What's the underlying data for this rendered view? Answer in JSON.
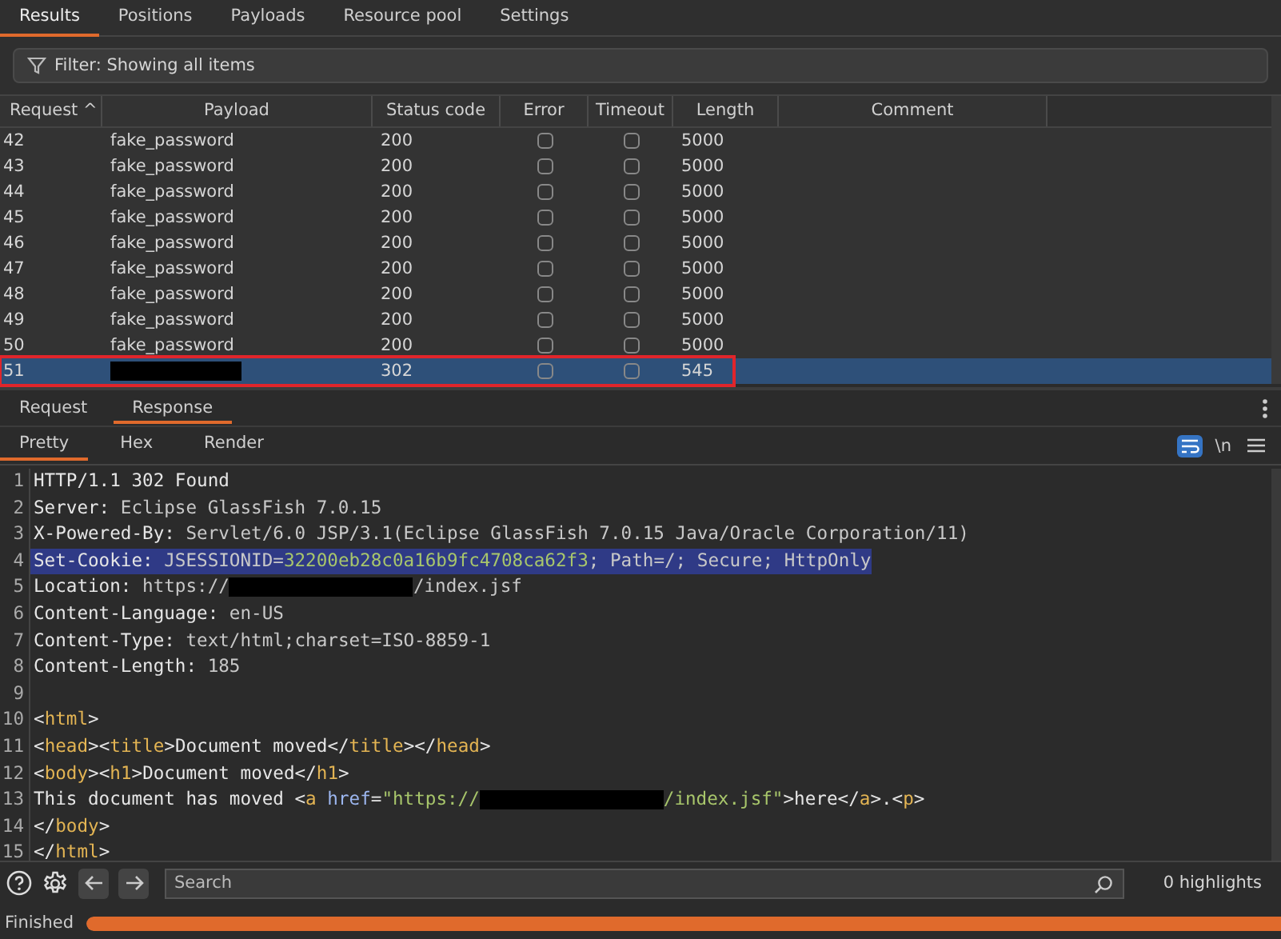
{
  "tabs": [
    {
      "label": "Results",
      "selected": true
    },
    {
      "label": "Positions",
      "selected": false
    },
    {
      "label": "Payloads",
      "selected": false
    },
    {
      "label": "Resource pool",
      "selected": false
    },
    {
      "label": "Settings",
      "selected": false
    }
  ],
  "filter": {
    "label": "Filter: Showing all items"
  },
  "table": {
    "columns": [
      {
        "label": "Request ^",
        "kind": "num"
      },
      {
        "label": "Payload",
        "kind": "text"
      },
      {
        "label": "Status code",
        "kind": "text"
      },
      {
        "label": "Error",
        "kind": "check"
      },
      {
        "label": "Timeout",
        "kind": "check"
      },
      {
        "label": "Length",
        "kind": "text"
      },
      {
        "label": "Comment",
        "kind": "text"
      }
    ],
    "rows": [
      {
        "request": "42",
        "payload": "fake_password",
        "status": "200",
        "error": false,
        "timeout": false,
        "length": "5000",
        "selected": false,
        "annotated": false
      },
      {
        "request": "43",
        "payload": "fake_password",
        "status": "200",
        "error": false,
        "timeout": false,
        "length": "5000",
        "selected": false,
        "annotated": false
      },
      {
        "request": "44",
        "payload": "fake_password",
        "status": "200",
        "error": false,
        "timeout": false,
        "length": "5000",
        "selected": false,
        "annotated": false
      },
      {
        "request": "45",
        "payload": "fake_password",
        "status": "200",
        "error": false,
        "timeout": false,
        "length": "5000",
        "selected": false,
        "annotated": false
      },
      {
        "request": "46",
        "payload": "fake_password",
        "status": "200",
        "error": false,
        "timeout": false,
        "length": "5000",
        "selected": false,
        "annotated": false
      },
      {
        "request": "47",
        "payload": "fake_password",
        "status": "200",
        "error": false,
        "timeout": false,
        "length": "5000",
        "selected": false,
        "annotated": false
      },
      {
        "request": "48",
        "payload": "fake_password",
        "status": "200",
        "error": false,
        "timeout": false,
        "length": "5000",
        "selected": false,
        "annotated": false
      },
      {
        "request": "49",
        "payload": "fake_password",
        "status": "200",
        "error": false,
        "timeout": false,
        "length": "5000",
        "selected": false,
        "annotated": false
      },
      {
        "request": "50",
        "payload": "fake_password",
        "status": "200",
        "error": false,
        "timeout": false,
        "length": "5000",
        "selected": false,
        "annotated": false
      },
      {
        "request": "51",
        "payload_redacted": true,
        "status": "302",
        "error": false,
        "timeout": false,
        "length": "545",
        "selected": true,
        "annotated": true
      }
    ]
  },
  "message_tabs": [
    {
      "label": "Request",
      "selected": false
    },
    {
      "label": "Response",
      "selected": true
    }
  ],
  "view_tabs": [
    {
      "label": "Pretty",
      "selected": true
    },
    {
      "label": "Hex",
      "selected": false
    },
    {
      "label": "Render",
      "selected": false
    }
  ],
  "view_tools": {
    "wrap_on": true,
    "newline_label": "\\n"
  },
  "code_lines": [
    {
      "number": "1",
      "selected": false,
      "parts": [
        {
          "kind": "plain",
          "text": "HTTP/1.1 302 Found"
        }
      ]
    },
    {
      "number": "2",
      "selected": false,
      "parts": [
        {
          "kind": "name",
          "text": "Server:"
        },
        {
          "kind": "value",
          "text": " Eclipse GlassFish 7.0.15"
        }
      ]
    },
    {
      "number": "3",
      "selected": false,
      "parts": [
        {
          "kind": "name",
          "text": "X-Powered-By:"
        },
        {
          "kind": "value",
          "text": " Servlet/6.0 JSP/3.1(Eclipse GlassFish 7.0.15 Java/Oracle Corporation/11)"
        }
      ]
    },
    {
      "number": "4",
      "selected": true,
      "parts": [
        {
          "kind": "name",
          "text": "Set-Cookie:"
        },
        {
          "kind": "value",
          "text": " JSESSIONID="
        },
        {
          "kind": "string",
          "text": "32200eb28c0a16b9fc4708ca62f3"
        },
        {
          "kind": "value",
          "text": "; Path=/; Secure; HttpOnly"
        }
      ]
    },
    {
      "number": "5",
      "selected": false,
      "parts": [
        {
          "kind": "name",
          "text": "Location:"
        },
        {
          "kind": "value",
          "text": " https://"
        },
        {
          "kind": "redacted"
        },
        {
          "kind": "value",
          "text": "/index.jsf"
        }
      ]
    },
    {
      "number": "6",
      "selected": false,
      "parts": [
        {
          "kind": "name",
          "text": "Content-Language:"
        },
        {
          "kind": "value",
          "text": " en-US"
        }
      ]
    },
    {
      "number": "7",
      "selected": false,
      "parts": [
        {
          "kind": "name",
          "text": "Content-Type:"
        },
        {
          "kind": "value",
          "text": " text/html;charset=ISO-8859-1"
        }
      ]
    },
    {
      "number": "8",
      "selected": false,
      "parts": [
        {
          "kind": "name",
          "text": "Content-Length:"
        },
        {
          "kind": "value",
          "text": " 185"
        }
      ]
    },
    {
      "number": "9",
      "selected": false
    },
    {
      "number": "10",
      "selected": false,
      "parts": [
        {
          "kind": "punct",
          "text": "<"
        },
        {
          "kind": "tag",
          "text": "html"
        },
        {
          "kind": "punct",
          "text": ">"
        }
      ]
    },
    {
      "number": "11",
      "selected": false,
      "parts": [
        {
          "kind": "punct",
          "text": "<"
        },
        {
          "kind": "tag",
          "text": "head"
        },
        {
          "kind": "punct",
          "text": "><"
        },
        {
          "kind": "tag",
          "text": "title"
        },
        {
          "kind": "punct",
          "text": ">"
        },
        {
          "kind": "plain",
          "text": "Document moved"
        },
        {
          "kind": "punct",
          "text": "</"
        },
        {
          "kind": "tag",
          "text": "title"
        },
        {
          "kind": "punct",
          "text": "></"
        },
        {
          "kind": "tag",
          "text": "head"
        },
        {
          "kind": "punct",
          "text": ">"
        }
      ]
    },
    {
      "number": "12",
      "selected": false,
      "parts": [
        {
          "kind": "punct",
          "text": "<"
        },
        {
          "kind": "tag",
          "text": "body"
        },
        {
          "kind": "punct",
          "text": "><"
        },
        {
          "kind": "tag",
          "text": "h1"
        },
        {
          "kind": "punct",
          "text": ">"
        },
        {
          "kind": "plain",
          "text": "Document moved"
        },
        {
          "kind": "punct",
          "text": "</"
        },
        {
          "kind": "tag",
          "text": "h1"
        },
        {
          "kind": "punct",
          "text": ">"
        }
      ]
    },
    {
      "number": "13",
      "selected": false,
      "parts": [
        {
          "kind": "plain",
          "text": "This document has moved "
        },
        {
          "kind": "punct",
          "text": "<"
        },
        {
          "kind": "tag",
          "text": "a"
        },
        {
          "kind": "attr",
          "text": " href"
        },
        {
          "kind": "punct",
          "text": "="
        },
        {
          "kind": "string",
          "text": "\"https://"
        },
        {
          "kind": "redacted"
        },
        {
          "kind": "string",
          "text": "/index.jsf\""
        },
        {
          "kind": "punct",
          "text": ">"
        },
        {
          "kind": "plain",
          "text": "here"
        },
        {
          "kind": "punct",
          "text": "</"
        },
        {
          "kind": "tag",
          "text": "a"
        },
        {
          "kind": "punct",
          "text": ">."
        },
        {
          "kind": "punct",
          "text": "<"
        },
        {
          "kind": "tag",
          "text": "p"
        },
        {
          "kind": "punct",
          "text": ">"
        }
      ]
    },
    {
      "number": "14",
      "selected": false,
      "parts": [
        {
          "kind": "punct",
          "text": "</"
        },
        {
          "kind": "tag",
          "text": "body"
        },
        {
          "kind": "punct",
          "text": ">"
        }
      ]
    },
    {
      "number": "15",
      "selected": false,
      "parts": [
        {
          "kind": "punct",
          "text": "</"
        },
        {
          "kind": "tag",
          "text": "html"
        },
        {
          "kind": "punct",
          "text": ">"
        }
      ]
    }
  ],
  "search": {
    "placeholder": "Search",
    "highlights": "0 highlights"
  },
  "status": {
    "label": "Finished",
    "level": 1
  }
}
